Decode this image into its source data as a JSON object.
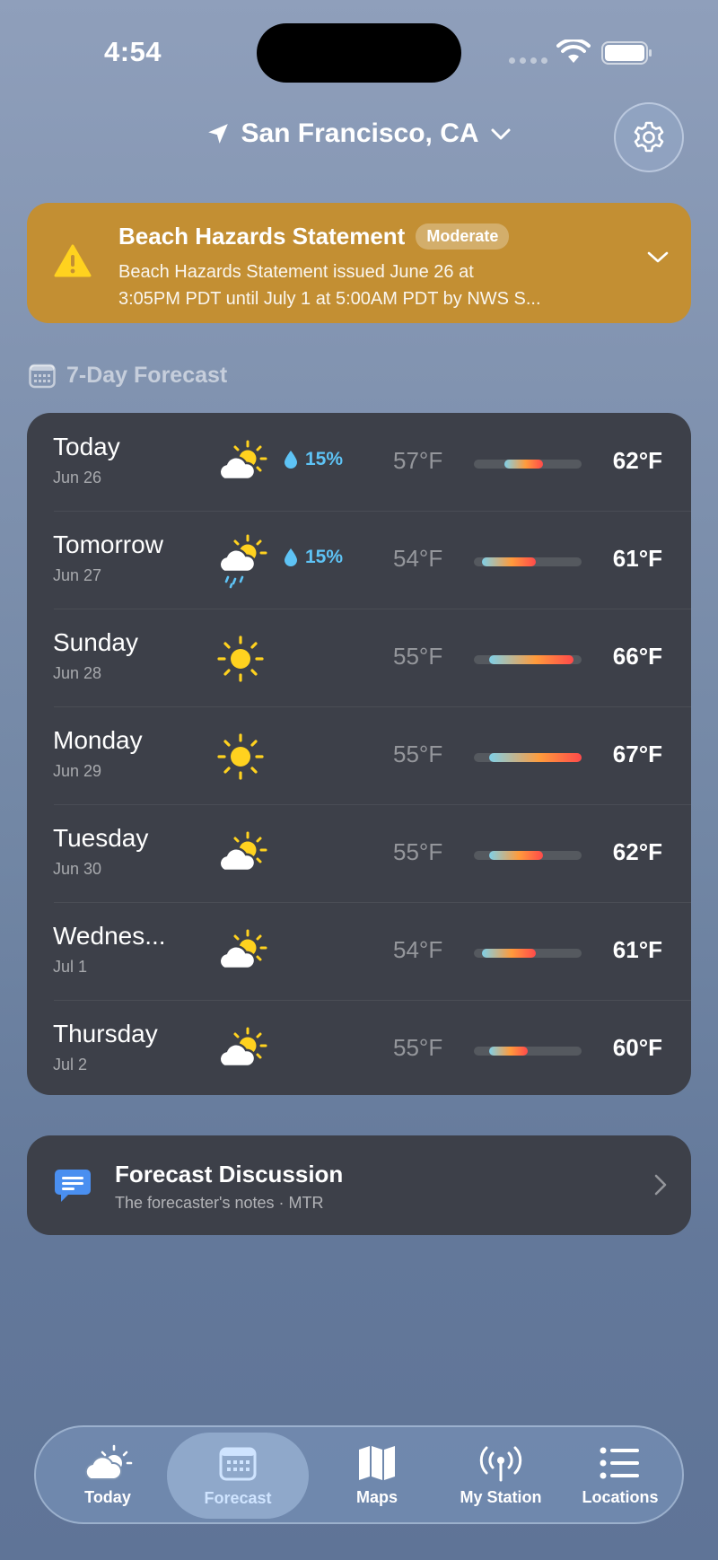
{
  "status": {
    "time": "4:54"
  },
  "header": {
    "location": "San Francisco, CA"
  },
  "alert": {
    "title": "Beach Hazards Statement",
    "badge": "Moderate",
    "desc_line1": "Beach Hazards Statement issued June 26 at",
    "desc_line2": "3:05PM PDT until July 1 at 5:00AM PDT by NWS S...",
    "color": "#c38f33"
  },
  "section": {
    "title": "7-Day Forecast"
  },
  "forecast": [
    {
      "day": "Today",
      "date": "Jun 26",
      "icon": "partly-sunny-icon",
      "precip": "15%",
      "low": "57°F",
      "high": "62°F"
    },
    {
      "day": "Tomorrow",
      "date": "Jun 27",
      "icon": "sun-rain-icon",
      "precip": "15%",
      "low": "54°F",
      "high": "61°F"
    },
    {
      "day": "Sunday",
      "date": "Jun 28",
      "icon": "sun-icon",
      "precip": "",
      "low": "55°F",
      "high": "66°F"
    },
    {
      "day": "Monday",
      "date": "Jun 29",
      "icon": "sun-icon",
      "precip": "",
      "low": "55°F",
      "high": "67°F"
    },
    {
      "day": "Tuesday",
      "date": "Jun 30",
      "icon": "partly-sunny-icon",
      "precip": "",
      "low": "55°F",
      "high": "62°F"
    },
    {
      "day": "Wednes...",
      "date": "Jul 1",
      "icon": "partly-sunny-icon",
      "precip": "",
      "low": "54°F",
      "high": "61°F"
    },
    {
      "day": "Thursday",
      "date": "Jul 2",
      "icon": "partly-sunny-icon",
      "precip": "",
      "low": "55°F",
      "high": "60°F"
    }
  ],
  "discussion": {
    "title": "Forecast Discussion",
    "subtitle": "The forecaster's notes · MTR"
  },
  "tabs": [
    {
      "label": "Today",
      "active": false
    },
    {
      "label": "Forecast",
      "active": true
    },
    {
      "label": "Maps",
      "active": false
    },
    {
      "label": "My Station",
      "active": false
    },
    {
      "label": "Locations",
      "active": false
    }
  ],
  "colors": {
    "accent": "#5ec3f5",
    "card": "#3d4049",
    "sun": "#ffd21f"
  }
}
